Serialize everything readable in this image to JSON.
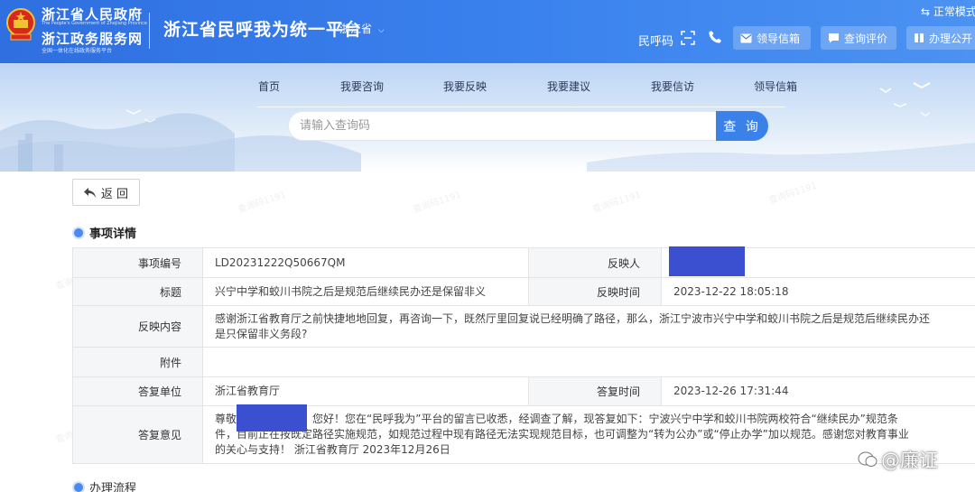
{
  "header": {
    "gov_title": "浙江省人民政府",
    "gov_subtitle_en": "The People's Government of Zhejiang Province",
    "gov_title2": "浙江政务服务网",
    "gov_subtitle_cn": "全国一体化在线政务服务平台",
    "platform_title": "浙江省民呼我为统一平台",
    "province": "浙江省",
    "mode": "⇆ 正常模式",
    "code_label": "民呼码",
    "buttons": [
      "领导信箱",
      "查询评价",
      "办理公开"
    ]
  },
  "nav": [
    "首页",
    "我要咨询",
    "我要反映",
    "我要建议",
    "我要信访",
    "领导信箱"
  ],
  "search": {
    "placeholder": "请输入查询码",
    "button": "查 询"
  },
  "back_label": "返 回",
  "section_title": "事项详情",
  "detail": {
    "item_no_label": "事项编号",
    "item_no": "LD20231222Q50667QM",
    "reporter_label": "反映人",
    "title_label": "标题",
    "title": "兴宁中学和蛟川书院之后是规范后继续民办还是保留非义",
    "report_time_label": "反映时间",
    "report_time": "2023-12-22 18:05:18",
    "content_label": "反映内容",
    "content": "感谢浙江省教育厅之前快捷地地回复，再咨询一下，既然厅里回复说已经明确了路径，那么，浙江宁波市兴宁中学和蛟川书院之后是规范后继续民办还是只保留非义务段?",
    "attachment_label": "附件",
    "reply_unit_label": "答复单位",
    "reply_unit": "浙江省教育厅",
    "reply_time_label": "答复时间",
    "reply_time": "2023-12-26 17:31:44",
    "reply_label": "答复意见",
    "reply_prefix": "尊敬",
    "reply_text": "您好！您在“民呼我为”平台的留言已收悉，经调查了解，现答复如下：宁波兴宁中学和蛟川书院两校符合“继续民办”规范条件，目前正在按既定路径实施规范，如规范过程中现有路径无法实现规范目标，也可调整为“转为公办”或“停止办学”加以规范。感谢您对教育事业的关心与支持！ 浙江省教育厅 2023年12月26日"
  },
  "section_title2": "办理流程",
  "watermark_text": "查询码1191",
  "corner_mark": "@廉证",
  "colors": {
    "header_blue": "#3b82ee",
    "accent": "#3a82ea",
    "redact": "#3b4fd1"
  }
}
